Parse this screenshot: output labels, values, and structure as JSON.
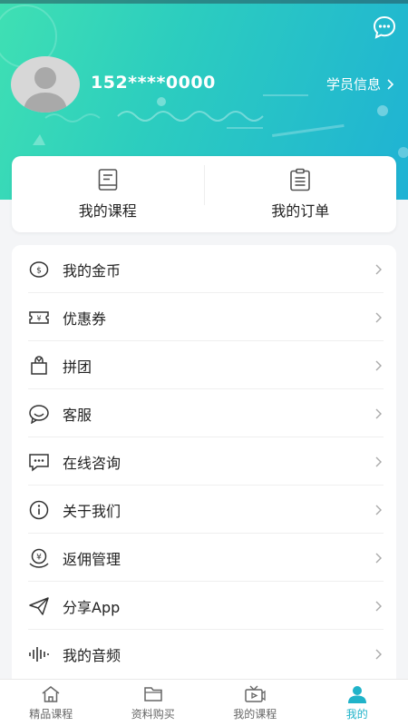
{
  "header": {
    "phone": "152****0000",
    "student_info_label": "学员信息"
  },
  "quick": [
    {
      "label": "我的课程",
      "icon": "book-icon"
    },
    {
      "label": "我的订单",
      "icon": "clipboard-icon"
    }
  ],
  "menu": [
    {
      "label": "我的金币",
      "icon": "coin-icon"
    },
    {
      "label": "优惠券",
      "icon": "coupon-icon"
    },
    {
      "label": "拼团",
      "icon": "group-buy-icon"
    },
    {
      "label": "客服",
      "icon": "customer-service-icon"
    },
    {
      "label": "在线咨询",
      "icon": "chat-icon"
    },
    {
      "label": "关于我们",
      "icon": "info-icon"
    },
    {
      "label": "返佣管理",
      "icon": "rebate-icon"
    },
    {
      "label": "分享App",
      "icon": "share-icon"
    },
    {
      "label": "我的音频",
      "icon": "audio-icon"
    }
  ],
  "tabs": [
    {
      "label": "精品课程",
      "icon": "home-icon",
      "active": false
    },
    {
      "label": "资料购买",
      "icon": "folder-icon",
      "active": false
    },
    {
      "label": "我的课程",
      "icon": "video-icon",
      "active": false
    },
    {
      "label": "我的",
      "icon": "user-icon",
      "active": true
    }
  ],
  "colors": {
    "accent": "#20b3c9",
    "gradient_start": "#3fe0b3",
    "gradient_end": "#1fb2d4"
  }
}
